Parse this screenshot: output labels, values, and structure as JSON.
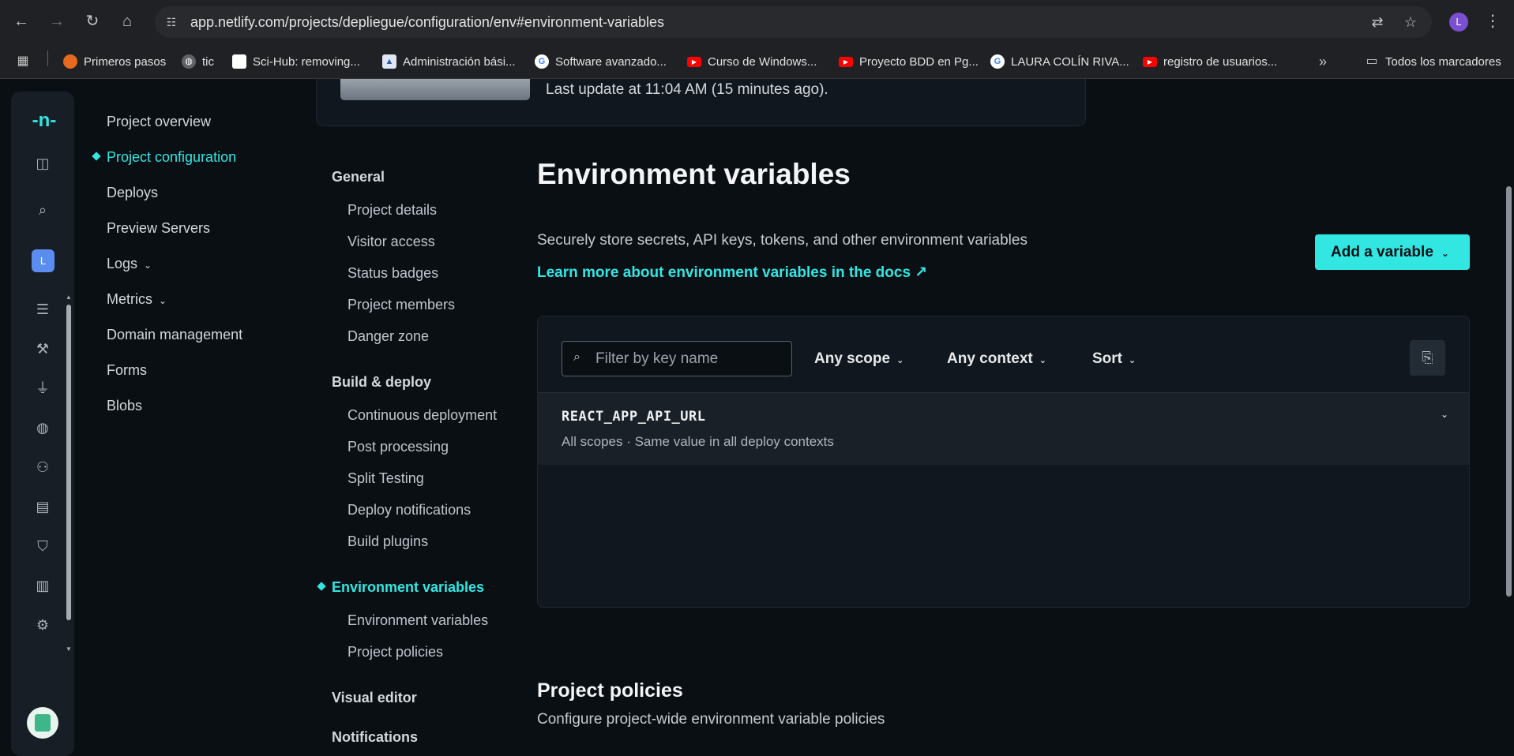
{
  "browser": {
    "url": "app.netlify.com/projects/depliegue/configuration/env#environment-variables",
    "profile_initial": "L",
    "bookmarks": [
      "Primeros pasos",
      "tic",
      "Sci-Hub: removing...",
      "Administración bási...",
      "Software avanzado...",
      "Curso de Windows...",
      "Proyecto BDD en Pg...",
      "LAURA COLÍN RIVA...",
      "registro de usuarios..."
    ],
    "bookmarks_more": "»",
    "all_bookmarks": "Todos los marcadores"
  },
  "rail": {
    "team_initial": "L"
  },
  "left_nav": {
    "items": [
      "Project overview",
      "Project configuration",
      "Deploys",
      "Preview Servers",
      "Logs",
      "Metrics",
      "Domain management",
      "Forms",
      "Blobs"
    ]
  },
  "sub_nav": {
    "general": "General",
    "general_items": [
      "Project details",
      "Visitor access",
      "Status badges",
      "Project members",
      "Danger zone"
    ],
    "build": "Build & deploy",
    "build_items": [
      "Continuous deployment",
      "Post processing",
      "Split Testing",
      "Deploy notifications",
      "Build plugins"
    ],
    "env": "Environment variables",
    "env_items": [
      "Environment variables",
      "Project policies"
    ],
    "visual": "Visual editor",
    "notifications": "Notifications"
  },
  "top_card": {
    "text": "Last update at 11:04 AM (15 minutes ago)."
  },
  "main": {
    "title": "Environment variables",
    "description": "Securely store secrets, API keys, tokens, and other environment variables",
    "doc_link": "Learn more about environment variables in the docs ↗",
    "add_button": "Add a variable",
    "filter_placeholder": "Filter by key name",
    "scope_dropdown": "Any scope",
    "context_dropdown": "Any context",
    "sort_dropdown": "Sort",
    "variables": [
      {
        "key": "REACT_APP_API_URL",
        "meta": "All scopes  ·  Same value in all deploy contexts"
      }
    ],
    "policies_title": "Project policies",
    "policies_description": "Configure project-wide environment variable policies"
  },
  "colors": {
    "accent": "#32e6e2",
    "background": "#0a0f14",
    "card": "#11171e"
  }
}
